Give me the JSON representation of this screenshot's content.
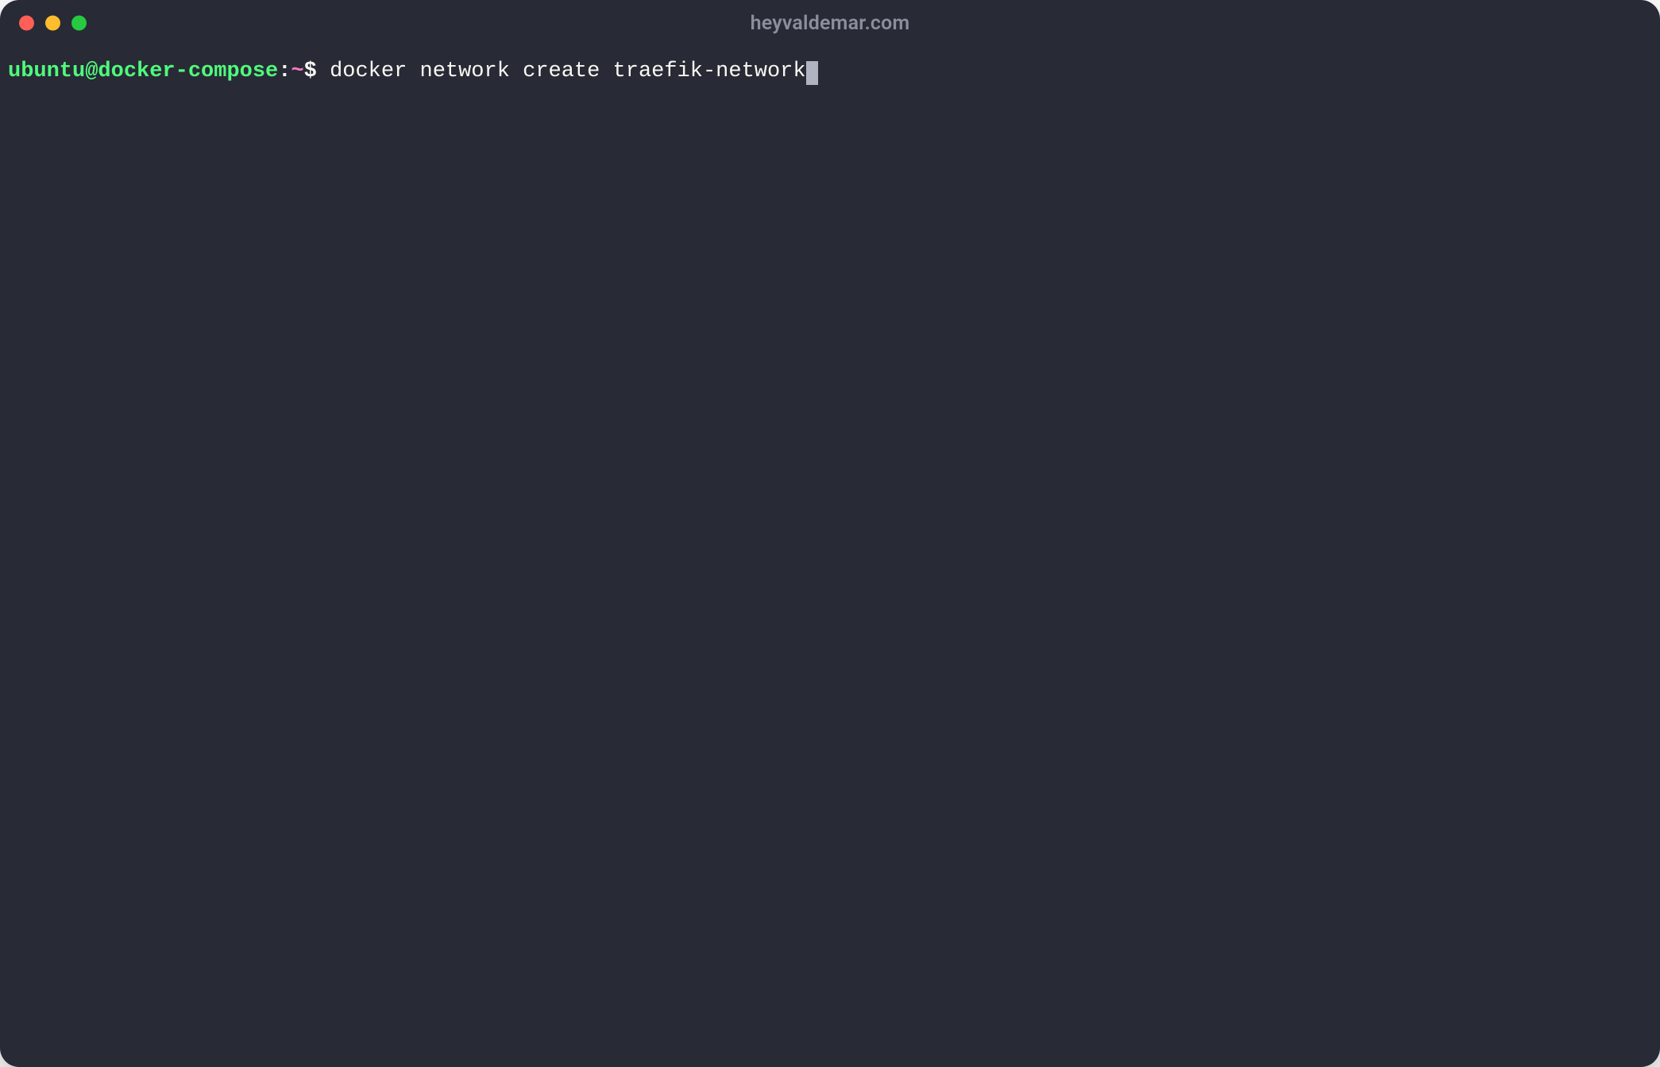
{
  "window": {
    "title": "heyvaldemar.com"
  },
  "prompt": {
    "user_host": "ubuntu@docker-compose",
    "separator": ":",
    "cwd": "~",
    "symbol": "$",
    "command": "docker network create traefik-network"
  },
  "colors": {
    "background": "#282a36",
    "prompt_user": "#50fa7b",
    "prompt_path": "#ff79c6",
    "text": "#f8f8f2",
    "close": "#ff5f56",
    "minimize": "#ffbd2e",
    "maximize": "#27c93f"
  }
}
